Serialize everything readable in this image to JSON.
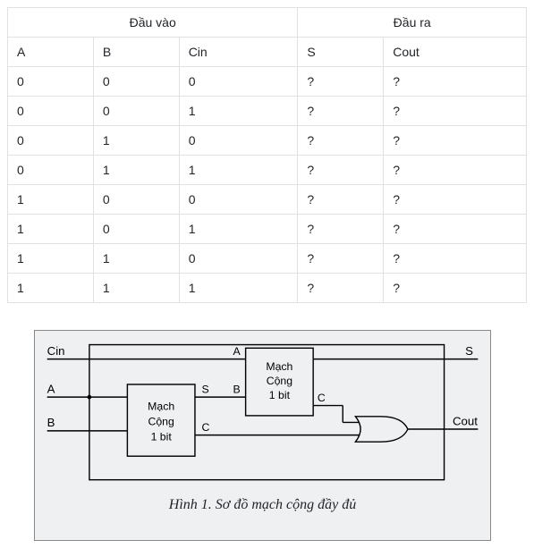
{
  "table": {
    "group_in": "Đầu vào",
    "group_out": "Đầu ra",
    "headers": {
      "a": "A",
      "b": "B",
      "cin": "Cin",
      "s": "S",
      "cout": "Cout"
    },
    "rows": [
      {
        "a": "0",
        "b": "0",
        "cin": "0",
        "s": "?",
        "cout": "?"
      },
      {
        "a": "0",
        "b": "0",
        "cin": "1",
        "s": "?",
        "cout": "?"
      },
      {
        "a": "0",
        "b": "1",
        "cin": "0",
        "s": "?",
        "cout": "?"
      },
      {
        "a": "0",
        "b": "1",
        "cin": "1",
        "s": "?",
        "cout": "?"
      },
      {
        "a": "1",
        "b": "0",
        "cin": "0",
        "s": "?",
        "cout": "?"
      },
      {
        "a": "1",
        "b": "0",
        "cin": "1",
        "s": "?",
        "cout": "?"
      },
      {
        "a": "1",
        "b": "1",
        "cin": "0",
        "s": "?",
        "cout": "?"
      },
      {
        "a": "1",
        "b": "1",
        "cin": "1",
        "s": "?",
        "cout": "?"
      }
    ]
  },
  "diagram": {
    "inputs": {
      "cin": "Cin",
      "a": "A",
      "b": "B"
    },
    "outputs": {
      "s": "S",
      "cout": "Cout"
    },
    "ha1": {
      "title1": "Mạch",
      "title2": "Cộng",
      "title3": "1 bit",
      "sumLabel": "S",
      "carryLabel": "C"
    },
    "ha2": {
      "title1": "Mạch",
      "title2": "Cộng",
      "title3": "1 bit",
      "inA": "A",
      "inB": "B",
      "carryLabel": "C"
    },
    "caption": "Hình 1. Sơ đồ mạch cộng đầy đủ"
  },
  "chart_data": {
    "type": "diagram",
    "description": "Full adder built from two half-adders and an OR gate",
    "truth_table": {
      "inputs": [
        "A",
        "B",
        "Cin"
      ],
      "outputs": [
        "S",
        "Cout"
      ],
      "rows": [
        {
          "A": 0,
          "B": 0,
          "Cin": 0,
          "S": "?",
          "Cout": "?"
        },
        {
          "A": 0,
          "B": 0,
          "Cin": 1,
          "S": "?",
          "Cout": "?"
        },
        {
          "A": 0,
          "B": 1,
          "Cin": 0,
          "S": "?",
          "Cout": "?"
        },
        {
          "A": 0,
          "B": 1,
          "Cin": 1,
          "S": "?",
          "Cout": "?"
        },
        {
          "A": 1,
          "B": 0,
          "Cin": 0,
          "S": "?",
          "Cout": "?"
        },
        {
          "A": 1,
          "B": 0,
          "Cin": 1,
          "S": "?",
          "Cout": "?"
        },
        {
          "A": 1,
          "B": 1,
          "Cin": 0,
          "S": "?",
          "Cout": "?"
        },
        {
          "A": 1,
          "B": 1,
          "Cin": 1,
          "S": "?",
          "Cout": "?"
        }
      ]
    },
    "blocks": [
      {
        "id": "HA1",
        "type": "half-adder",
        "label": "Mạch Cộng 1 bit",
        "inputs": [
          "A",
          "B"
        ],
        "outputs": [
          "S",
          "C"
        ]
      },
      {
        "id": "HA2",
        "type": "half-adder",
        "label": "Mạch Cộng 1 bit",
        "inputs": [
          "A",
          "B"
        ],
        "outputs": [
          "S",
          "C"
        ]
      },
      {
        "id": "OR1",
        "type": "or-gate",
        "inputs": [
          "in1",
          "in2"
        ],
        "outputs": [
          "out"
        ]
      }
    ],
    "connections": [
      {
        "from": "external.A",
        "to": "HA1.A"
      },
      {
        "from": "external.B",
        "to": "HA1.B"
      },
      {
        "from": "external.Cin",
        "to": "HA2.A"
      },
      {
        "from": "HA1.S",
        "to": "HA2.B"
      },
      {
        "from": "HA2.S",
        "to": "external.S"
      },
      {
        "from": "HA2.C",
        "to": "OR1.in1"
      },
      {
        "from": "HA1.C",
        "to": "OR1.in2"
      },
      {
        "from": "OR1.out",
        "to": "external.Cout"
      }
    ]
  }
}
